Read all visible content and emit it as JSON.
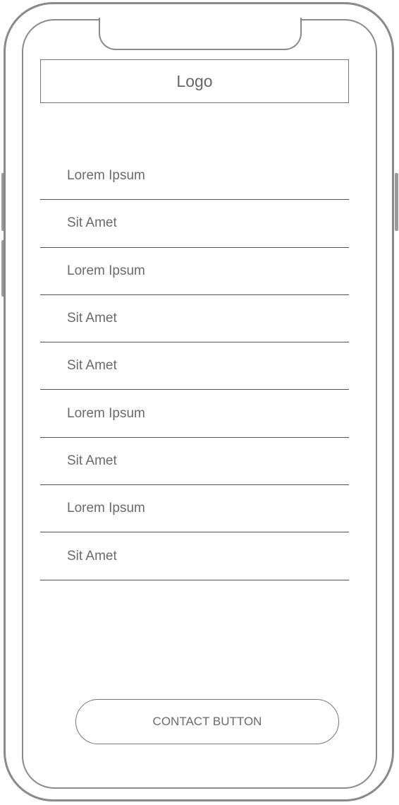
{
  "header": {
    "logo_text": "Logo"
  },
  "menu": {
    "items": [
      {
        "label": "Lorem Ipsum"
      },
      {
        "label": "Sit Amet"
      },
      {
        "label": "Lorem Ipsum"
      },
      {
        "label": "Sit Amet"
      },
      {
        "label": "Sit Amet"
      },
      {
        "label": "Lorem Ipsum"
      },
      {
        "label": "Sit Amet"
      },
      {
        "label": "Lorem Ipsum"
      },
      {
        "label": "Sit Amet"
      }
    ]
  },
  "footer": {
    "contact_button_label": "CONTACT BUTTON"
  },
  "colors": {
    "frame": "#8a8a8a",
    "text": "#6a6a6a",
    "divider": "#555555"
  }
}
